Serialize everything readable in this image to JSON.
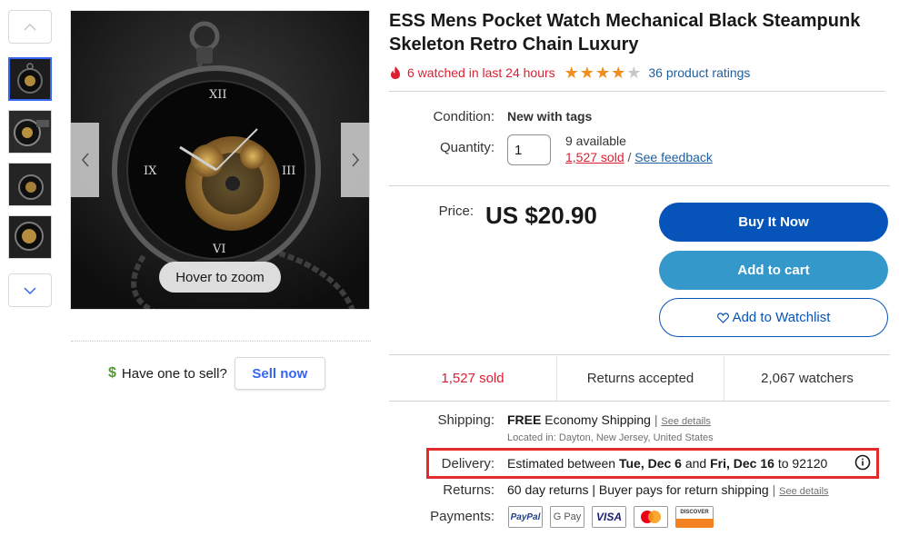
{
  "gallery": {
    "zoom_hint": "Hover to zoom",
    "thumbnail_count": 4
  },
  "sell": {
    "prompt": "Have one to sell?",
    "button": "Sell now"
  },
  "product": {
    "title": "ESS Mens Pocket Watch Mechanical Black Steampunk Skeleton Retro Chain Luxury",
    "watched": "6 watched in last 24 hours",
    "rating_stars": 4,
    "ratings_text": "36 product ratings"
  },
  "condition": {
    "label": "Condition:",
    "value": "New with tags"
  },
  "quantity": {
    "label": "Quantity:",
    "value": "1",
    "available": "9 available",
    "sold_link": "1,527 sold",
    "separator": "/",
    "feedback_link": "See feedback"
  },
  "price": {
    "label": "Price:",
    "value": "US $20.90"
  },
  "actions": {
    "buy_now": "Buy It Now",
    "add_to_cart": "Add to cart",
    "watchlist": "Add to Watchlist"
  },
  "stats": {
    "sold": "1,527 sold",
    "returns": "Returns accepted",
    "watchers": "2,067 watchers"
  },
  "shipping": {
    "label": "Shipping:",
    "free": "FREE",
    "method": "Economy Shipping",
    "divider": "|",
    "details_link": "See details",
    "location": "Located in: Dayton, New Jersey, United States"
  },
  "delivery": {
    "label": "Delivery:",
    "prefix": "Estimated between",
    "start": "Tue, Dec 6",
    "and": "and",
    "end": "Fri, Dec 16",
    "to": "to",
    "zip": "92120"
  },
  "returns": {
    "label": "Returns:",
    "value": "60 day returns | Buyer pays for return shipping",
    "divider": "|",
    "details_link": "See details"
  },
  "payments": {
    "label": "Payments:",
    "methods": [
      "PayPal",
      "G Pay",
      "VISA",
      "",
      "DISCOVER"
    ]
  },
  "colors": {
    "accent_blue": "#0654ba",
    "cart_blue": "#3498ca",
    "alert_red": "#dd1e31",
    "star_orange": "#f18e1d"
  }
}
